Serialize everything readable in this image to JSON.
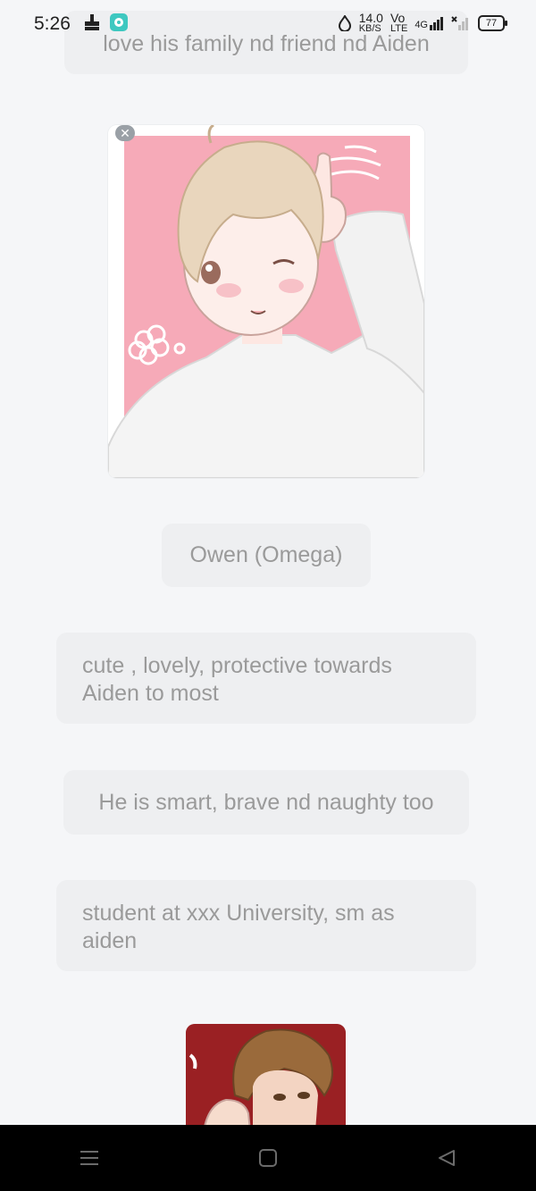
{
  "status_bar": {
    "time": "5:26",
    "net_speed_value": "14.0",
    "net_speed_unit": "KB/S",
    "volte_label_top": "Vo",
    "volte_label_bottom": "LTE",
    "network_type": "4G",
    "battery": "77"
  },
  "messages": [
    {
      "text": "love his family nd friend nd Aiden"
    },
    {
      "text": "Owen (Omega)"
    },
    {
      "text": "cute , lovely, protective towards Aiden to most"
    },
    {
      "text": "He is smart, brave nd naughty too"
    },
    {
      "text": "student at xxx University, sm as aiden"
    }
  ],
  "icons": {
    "close": "close-icon",
    "menu": "menu-icon",
    "home": "home-icon",
    "back": "back-icon"
  },
  "colors": {
    "background": "#f5f6f8",
    "bubble": "#eeeff1",
    "bubble_text": "#9a9a9a",
    "avatar_bg": "#f6aab8"
  }
}
